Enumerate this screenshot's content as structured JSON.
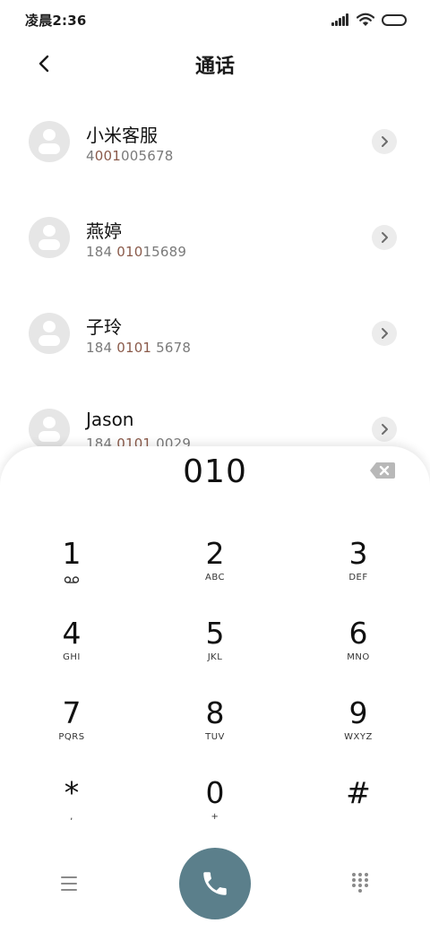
{
  "status_bar": {
    "time": "凌晨2:36"
  },
  "header": {
    "title": "通话"
  },
  "contacts": [
    {
      "name": "小米客服",
      "number_pre": "4",
      "number_match": "001",
      "number_post": "005678"
    },
    {
      "name": "燕婷",
      "number_pre": "184 ",
      "number_match": "010",
      "number_post": "15689"
    },
    {
      "name": "子玲",
      "number_pre": "184 ",
      "number_match": "0101",
      "number_post": " 5678"
    },
    {
      "name": "Jason",
      "number_pre": "184 ",
      "number_match": "0101",
      "number_post": " 0029"
    }
  ],
  "dialer": {
    "input_value": "010",
    "keys": [
      {
        "digit": "1",
        "letters": "",
        "icon": "voicemail-icon"
      },
      {
        "digit": "2",
        "letters": "ABC"
      },
      {
        "digit": "3",
        "letters": "DEF"
      },
      {
        "digit": "4",
        "letters": "GHI"
      },
      {
        "digit": "5",
        "letters": "JKL"
      },
      {
        "digit": "6",
        "letters": "MNO"
      },
      {
        "digit": "7",
        "letters": "PQRS"
      },
      {
        "digit": "8",
        "letters": "TUV"
      },
      {
        "digit": "9",
        "letters": "WXYZ"
      },
      {
        "digit": "*",
        "letters": ","
      },
      {
        "digit": "0",
        "letters": "+"
      },
      {
        "digit": "#",
        "letters": ""
      }
    ]
  },
  "colors": {
    "call_button": "#5b7f8b",
    "match_highlight": "#8a5a4a",
    "avatar_bg": "#e6e6e6"
  }
}
